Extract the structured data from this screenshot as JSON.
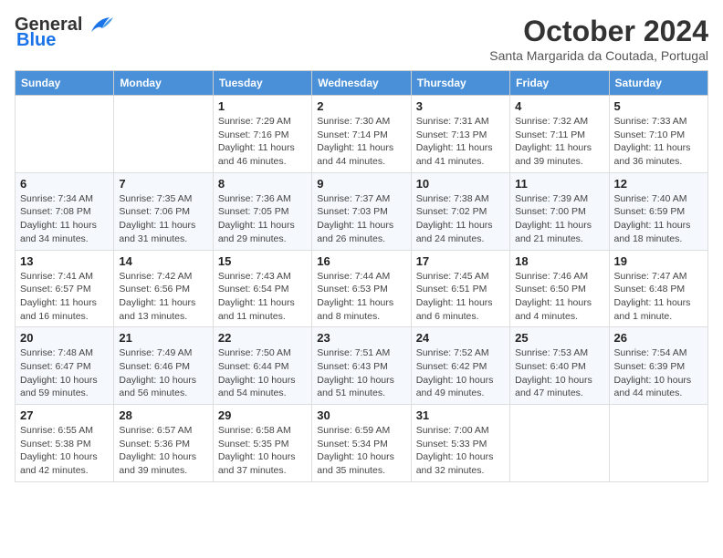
{
  "header": {
    "logo_line1": "General",
    "logo_line2": "Blue",
    "month_title": "October 2024",
    "subtitle": "Santa Margarida da Coutada, Portugal"
  },
  "weekdays": [
    "Sunday",
    "Monday",
    "Tuesday",
    "Wednesday",
    "Thursday",
    "Friday",
    "Saturday"
  ],
  "weeks": [
    [
      {
        "day": "",
        "info": ""
      },
      {
        "day": "",
        "info": ""
      },
      {
        "day": "1",
        "info": "Sunrise: 7:29 AM\nSunset: 7:16 PM\nDaylight: 11 hours and 46 minutes."
      },
      {
        "day": "2",
        "info": "Sunrise: 7:30 AM\nSunset: 7:14 PM\nDaylight: 11 hours and 44 minutes."
      },
      {
        "day": "3",
        "info": "Sunrise: 7:31 AM\nSunset: 7:13 PM\nDaylight: 11 hours and 41 minutes."
      },
      {
        "day": "4",
        "info": "Sunrise: 7:32 AM\nSunset: 7:11 PM\nDaylight: 11 hours and 39 minutes."
      },
      {
        "day": "5",
        "info": "Sunrise: 7:33 AM\nSunset: 7:10 PM\nDaylight: 11 hours and 36 minutes."
      }
    ],
    [
      {
        "day": "6",
        "info": "Sunrise: 7:34 AM\nSunset: 7:08 PM\nDaylight: 11 hours and 34 minutes."
      },
      {
        "day": "7",
        "info": "Sunrise: 7:35 AM\nSunset: 7:06 PM\nDaylight: 11 hours and 31 minutes."
      },
      {
        "day": "8",
        "info": "Sunrise: 7:36 AM\nSunset: 7:05 PM\nDaylight: 11 hours and 29 minutes."
      },
      {
        "day": "9",
        "info": "Sunrise: 7:37 AM\nSunset: 7:03 PM\nDaylight: 11 hours and 26 minutes."
      },
      {
        "day": "10",
        "info": "Sunrise: 7:38 AM\nSunset: 7:02 PM\nDaylight: 11 hours and 24 minutes."
      },
      {
        "day": "11",
        "info": "Sunrise: 7:39 AM\nSunset: 7:00 PM\nDaylight: 11 hours and 21 minutes."
      },
      {
        "day": "12",
        "info": "Sunrise: 7:40 AM\nSunset: 6:59 PM\nDaylight: 11 hours and 18 minutes."
      }
    ],
    [
      {
        "day": "13",
        "info": "Sunrise: 7:41 AM\nSunset: 6:57 PM\nDaylight: 11 hours and 16 minutes."
      },
      {
        "day": "14",
        "info": "Sunrise: 7:42 AM\nSunset: 6:56 PM\nDaylight: 11 hours and 13 minutes."
      },
      {
        "day": "15",
        "info": "Sunrise: 7:43 AM\nSunset: 6:54 PM\nDaylight: 11 hours and 11 minutes."
      },
      {
        "day": "16",
        "info": "Sunrise: 7:44 AM\nSunset: 6:53 PM\nDaylight: 11 hours and 8 minutes."
      },
      {
        "day": "17",
        "info": "Sunrise: 7:45 AM\nSunset: 6:51 PM\nDaylight: 11 hours and 6 minutes."
      },
      {
        "day": "18",
        "info": "Sunrise: 7:46 AM\nSunset: 6:50 PM\nDaylight: 11 hours and 4 minutes."
      },
      {
        "day": "19",
        "info": "Sunrise: 7:47 AM\nSunset: 6:48 PM\nDaylight: 11 hours and 1 minute."
      }
    ],
    [
      {
        "day": "20",
        "info": "Sunrise: 7:48 AM\nSunset: 6:47 PM\nDaylight: 10 hours and 59 minutes."
      },
      {
        "day": "21",
        "info": "Sunrise: 7:49 AM\nSunset: 6:46 PM\nDaylight: 10 hours and 56 minutes."
      },
      {
        "day": "22",
        "info": "Sunrise: 7:50 AM\nSunset: 6:44 PM\nDaylight: 10 hours and 54 minutes."
      },
      {
        "day": "23",
        "info": "Sunrise: 7:51 AM\nSunset: 6:43 PM\nDaylight: 10 hours and 51 minutes."
      },
      {
        "day": "24",
        "info": "Sunrise: 7:52 AM\nSunset: 6:42 PM\nDaylight: 10 hours and 49 minutes."
      },
      {
        "day": "25",
        "info": "Sunrise: 7:53 AM\nSunset: 6:40 PM\nDaylight: 10 hours and 47 minutes."
      },
      {
        "day": "26",
        "info": "Sunrise: 7:54 AM\nSunset: 6:39 PM\nDaylight: 10 hours and 44 minutes."
      }
    ],
    [
      {
        "day": "27",
        "info": "Sunrise: 6:55 AM\nSunset: 5:38 PM\nDaylight: 10 hours and 42 minutes."
      },
      {
        "day": "28",
        "info": "Sunrise: 6:57 AM\nSunset: 5:36 PM\nDaylight: 10 hours and 39 minutes."
      },
      {
        "day": "29",
        "info": "Sunrise: 6:58 AM\nSunset: 5:35 PM\nDaylight: 10 hours and 37 minutes."
      },
      {
        "day": "30",
        "info": "Sunrise: 6:59 AM\nSunset: 5:34 PM\nDaylight: 10 hours and 35 minutes."
      },
      {
        "day": "31",
        "info": "Sunrise: 7:00 AM\nSunset: 5:33 PM\nDaylight: 10 hours and 32 minutes."
      },
      {
        "day": "",
        "info": ""
      },
      {
        "day": "",
        "info": ""
      }
    ]
  ]
}
